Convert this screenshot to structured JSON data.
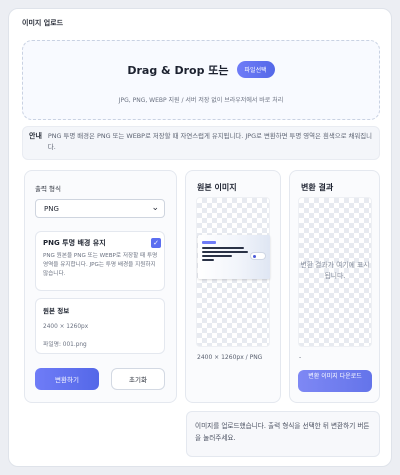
{
  "section_title": "이미지 업로드",
  "dropzone": {
    "title": "Drag & Drop 또는",
    "choose_button": "파일선택",
    "subtitle": "JPG, PNG, WEBP 지원 / 서버 저장 없이 브라우저에서 바로 처리"
  },
  "notice": {
    "label": "안내",
    "text": "PNG 투명 배경은 PNG 또는 WEBP로 저장할 때 자연스럽게 유지됩니다. JPG로 변환하면 투명 영역은 흰색으로 채워집니다."
  },
  "options": {
    "format_label": "출력 형식",
    "format_value": "PNG",
    "keep_transparency": {
      "title": "PNG 투명 배경 유지",
      "checked": true,
      "description": "PNG 원본을 PNG 또는 WEBP로 저장할 때 투명 영역을 유지합니다. JPG는 투명 배경을 지원하지 않습니다."
    },
    "source_info": {
      "title": "원본 정보",
      "dimensions": "2400 × 1260px",
      "filename": "파일명: 001.png"
    },
    "convert_button": "변환하기",
    "reset_button": "초기화"
  },
  "original": {
    "title": "원본 이미지",
    "meta": "2400 × 1260px / PNG"
  },
  "result": {
    "title": "변환 결과",
    "placeholder": "변환 결과가 여기에 표시됩니다.",
    "meta": "-",
    "download_button": "변환 이미지 다운로드"
  },
  "status_message": "이미지를 업로드했습니다. 출력 형식을 선택한 뒤 변환하기 버튼을 눌러주세요.",
  "colors": {
    "accent": "#5b6ef0",
    "background": "#eceef3"
  }
}
